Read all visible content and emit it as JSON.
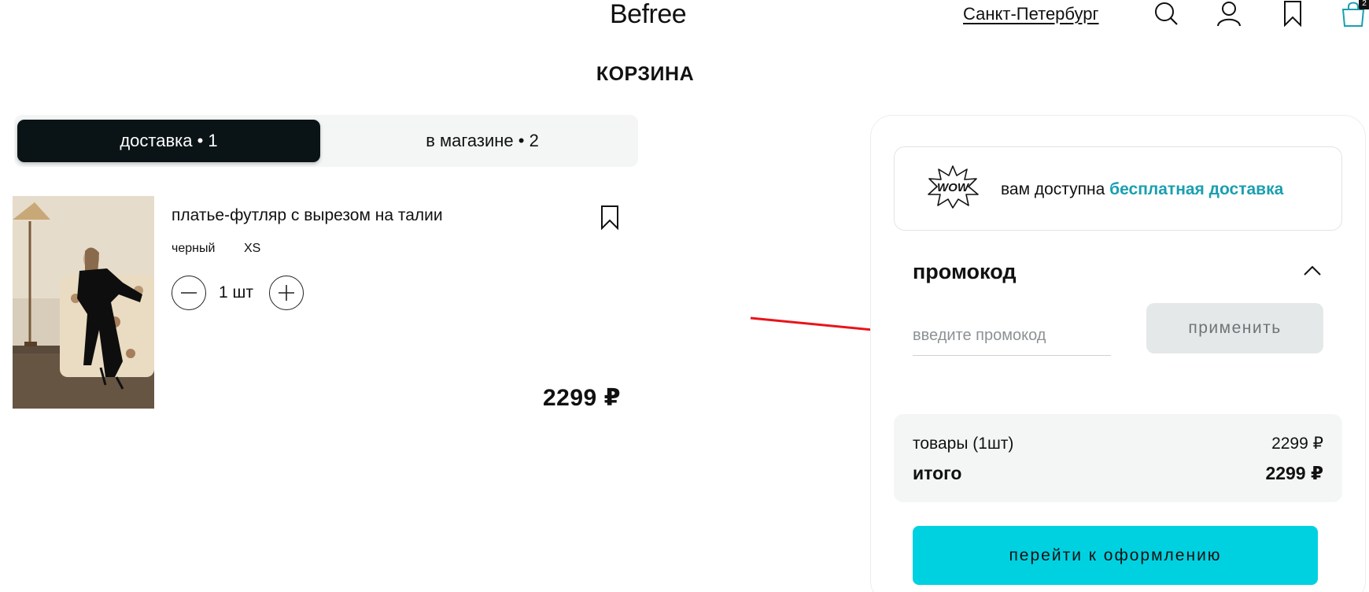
{
  "header": {
    "logo": "Befree",
    "city": "Санкт-Петербург",
    "icons": [
      "search-icon",
      "user-icon",
      "bookmark-icon",
      "cart-icon"
    ],
    "cart_count": "2"
  },
  "page_title": "КОРЗИНА",
  "tabs": [
    {
      "label": "доставка • 1",
      "active": true
    },
    {
      "label": "в магазине • 2",
      "active": false
    }
  ],
  "cart_items": [
    {
      "name": "платье-футляр с вырезом на талии",
      "color": "черный",
      "size": "XS",
      "quantity": "1 шт",
      "price": "2299 ₽"
    }
  ],
  "promo_banner": {
    "text": "вам доступна",
    "highlight": "бесплатная доставка"
  },
  "promo": {
    "title": "промокод",
    "placeholder": "введите промокод",
    "apply_label": "применить"
  },
  "summary": {
    "items_label": "товары (1шт)",
    "items_value": "2299 ₽",
    "total_label": "итого",
    "total_value": "2299 ₽"
  },
  "checkout_label": "перейти к оформлению",
  "colors": {
    "accent": "#00d1e1",
    "highlight_text": "#1a9fb0",
    "tab_active_bg": "#0a1416",
    "annotation_arrow": "#e8141a"
  }
}
